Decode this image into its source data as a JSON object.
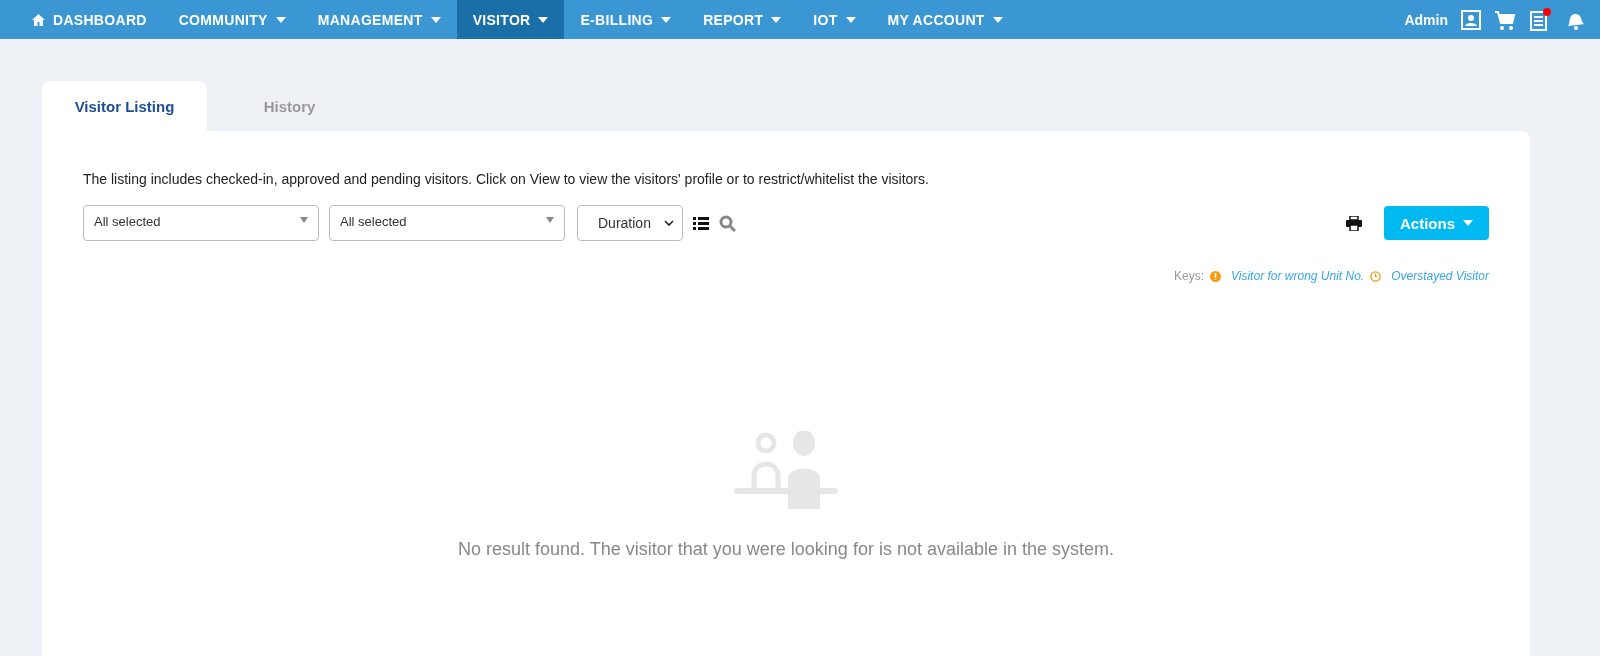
{
  "nav": {
    "items": [
      {
        "label": "DASHBOARD",
        "kind": "home",
        "selected": false,
        "dropdown": false
      },
      {
        "label": "COMMUNITY",
        "kind": "menu",
        "selected": false,
        "dropdown": true
      },
      {
        "label": "MANAGEMENT",
        "kind": "menu",
        "selected": false,
        "dropdown": true
      },
      {
        "label": "VISITOR",
        "kind": "menu",
        "selected": true,
        "dropdown": true
      },
      {
        "label": "E-BILLING",
        "kind": "menu",
        "selected": false,
        "dropdown": true
      },
      {
        "label": "REPORT",
        "kind": "menu",
        "selected": false,
        "dropdown": true
      },
      {
        "label": "IOT",
        "kind": "menu",
        "selected": false,
        "dropdown": true
      },
      {
        "label": "MY ACCOUNT",
        "kind": "menu",
        "selected": false,
        "dropdown": true
      }
    ],
    "user": "Admin",
    "notes_unread": true
  },
  "tabs": [
    {
      "label": "Visitor Listing",
      "selected": true
    },
    {
      "label": "History",
      "selected": false
    }
  ],
  "intro": "The listing includes checked-in, approved and pending visitors. Click on View to view the visitors' profile or to restrict/whitelist the visitors.",
  "filters": [
    {
      "value": "All selected"
    },
    {
      "value": "All selected"
    }
  ],
  "duration": "Duration",
  "actions_button": "Actions",
  "keys": {
    "label": "Keys:",
    "items": [
      {
        "kind": "alert",
        "text": "Visitor for wrong Unit No."
      },
      {
        "kind": "clock",
        "text": "Overstayed Visitor"
      }
    ]
  },
  "empty_message": "No result found. The visitor that you were looking for is not available in the system."
}
